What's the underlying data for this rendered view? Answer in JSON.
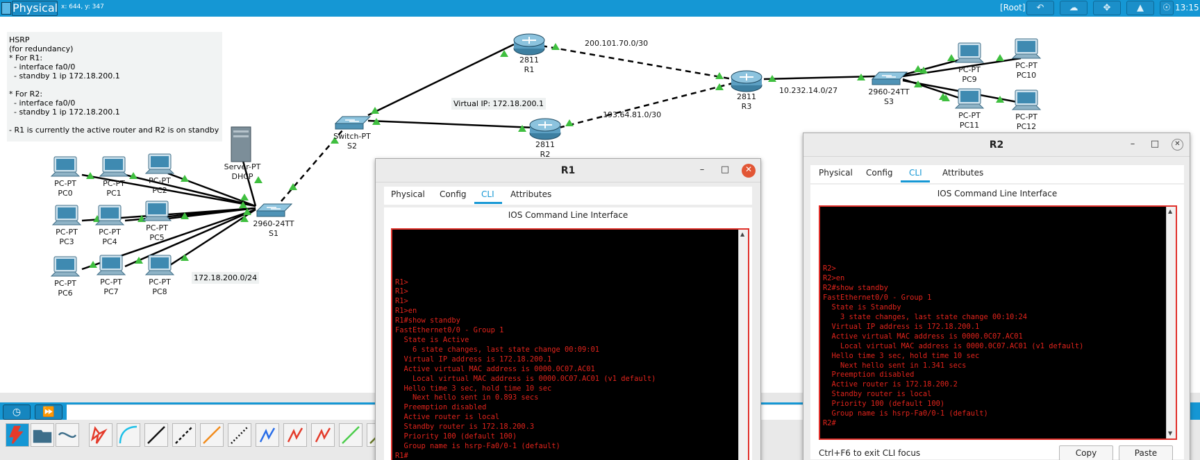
{
  "topbar": {
    "mode": "Physical",
    "coords": "x: 644, y: 347",
    "root": "[Root]",
    "clock": "13:15"
  },
  "note": {
    "text": "HSRP\n(for redundancy)\n* For R1:\n  - interface fa0/0\n  - standby 1 ip 172.18.200.1\n\n* For R2:\n  - interface fa0/0\n  - standby 1 ip 172.18.200.1\n\n- R1 is currently the active router and R2 is on standby"
  },
  "labels": {
    "net1": "200.101.70.0/30",
    "net2": "193.64.81.0/30",
    "net3": "10.232.14.0/27",
    "lan": "172.18.200.0/24",
    "vip": "Virtual IP: 172.18.200.1"
  },
  "devices": {
    "R1": {
      "model": "2811",
      "name": "R1"
    },
    "R2": {
      "model": "2811",
      "name": "R2"
    },
    "R3": {
      "model": "2811",
      "name": "R3"
    },
    "S1": {
      "model": "2960-24TT",
      "name": "S1"
    },
    "S2": {
      "model": "Switch-PT",
      "name": "S2"
    },
    "S3": {
      "model": "2960-24TT",
      "name": "S3"
    },
    "server": {
      "model": "Server-PT",
      "name": "DHCP"
    },
    "pcs": [
      {
        "model": "PC-PT",
        "name": "PC0"
      },
      {
        "model": "PC-PT",
        "name": "PC1"
      },
      {
        "model": "PC-PT",
        "name": "PC2"
      },
      {
        "model": "PC-PT",
        "name": "PC3"
      },
      {
        "model": "PC-PT",
        "name": "PC4"
      },
      {
        "model": "PC-PT",
        "name": "PC5"
      },
      {
        "model": "PC-PT",
        "name": "PC6"
      },
      {
        "model": "PC-PT",
        "name": "PC7"
      },
      {
        "model": "PC-PT",
        "name": "PC8"
      },
      {
        "model": "PC-PT",
        "name": "PC9"
      },
      {
        "model": "PC-PT",
        "name": "PC10"
      },
      {
        "model": "PC-PT",
        "name": "PC11"
      },
      {
        "model": "PC-PT",
        "name": "PC12"
      }
    ]
  },
  "window_r1": {
    "title": "R1",
    "tabs": [
      "Physical",
      "Config",
      "CLI",
      "Attributes"
    ],
    "active_tab": "CLI",
    "pane_title": "IOS Command Line Interface",
    "console": "\n\n\n\n\nR1>\nR1>\nR1>\nR1>en\nR1#show standby\nFastEthernet0/0 - Group 1\n  State is Active\n    6 state changes, last state change 00:09:01\n  Virtual IP address is 172.18.200.1\n  Active virtual MAC address is 0000.0C07.AC01\n    Local virtual MAC address is 0000.0C07.AC01 (v1 default)\n  Hello time 3 sec, hold time 10 sec\n    Next hello sent in 0.893 secs\n  Preemption disabled\n  Active router is local\n  Standby router is 172.18.200.3\n  Priority 100 (default 100)\n  Group name is hsrp-Fa0/0-1 (default)\nR1#"
  },
  "window_r2": {
    "title": "R2",
    "tabs": [
      "Physical",
      "Config",
      "CLI",
      "Attributes"
    ],
    "active_tab": "CLI",
    "pane_title": "IOS Command Line Interface",
    "console": "\n\n\n\n\n\nR2>\nR2>en\nR2#show standby\nFastEthernet0/0 - Group 1\n  State is Standby\n    3 state changes, last state change 00:10:24\n  Virtual IP address is 172.18.200.1\n  Active virtual MAC address is 0000.0C07.AC01\n    Local virtual MAC address is 0000.0C07.AC01 (v1 default)\n  Hello time 3 sec, hold time 10 sec\n    Next hello sent in 1.341 secs\n  Preemption disabled\n  Active router is 172.18.200.2\n  Standby router is local\n  Priority 100 (default 100)\n  Group name is hsrp-Fa0/0-1 (default)\nR2#",
    "hint": "Ctrl+F6 to exit CLI focus",
    "copy": "Copy",
    "paste": "Paste"
  },
  "icons": {
    "menu": "list-icon",
    "undo": "undo-icon",
    "cloud": "cloud-icon",
    "move": "move-icon",
    "mountain": "landscape-icon",
    "globe": "network-icon",
    "time": "clock-icon",
    "fast_forward": "fast-forward-icon"
  },
  "colors": {
    "accent": "#1597d4",
    "console_text": "#e3241c",
    "link_up": "#3fbf3f",
    "close": "#e25635"
  }
}
